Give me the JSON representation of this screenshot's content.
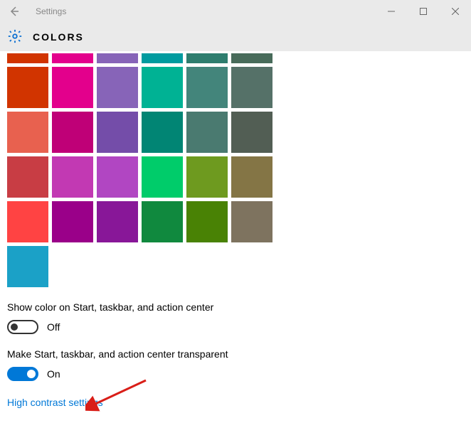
{
  "app": {
    "title": "Settings"
  },
  "page": {
    "heading": "COLORS"
  },
  "palette_row_partial": [
    "#d13400",
    "#e3008c",
    "#8764b8",
    "#009b9f",
    "#2e7d6e",
    "#486b5a"
  ],
  "palette": [
    "#d13400",
    "#e3008c",
    "#8764b8",
    "#00b294",
    "#43857b",
    "#557168",
    "#e8614f",
    "#bf0077",
    "#744da9",
    "#018574",
    "#4a7a70",
    "#525e54",
    "#c83d44",
    "#c239b3",
    "#b146c2",
    "#00cc6a",
    "#6e9a1f",
    "#847545",
    "#ff4343",
    "#9a0089",
    "#881798",
    "#10893e",
    "#498205",
    "#7e735f",
    "#1ba1c7"
  ],
  "settings": {
    "show_color_label": "Show color on Start, taskbar, and action center",
    "show_color_state": "Off",
    "transparent_label": "Make Start, taskbar, and action center transparent",
    "transparent_state": "On"
  },
  "link": {
    "high_contrast": "High contrast settings"
  }
}
